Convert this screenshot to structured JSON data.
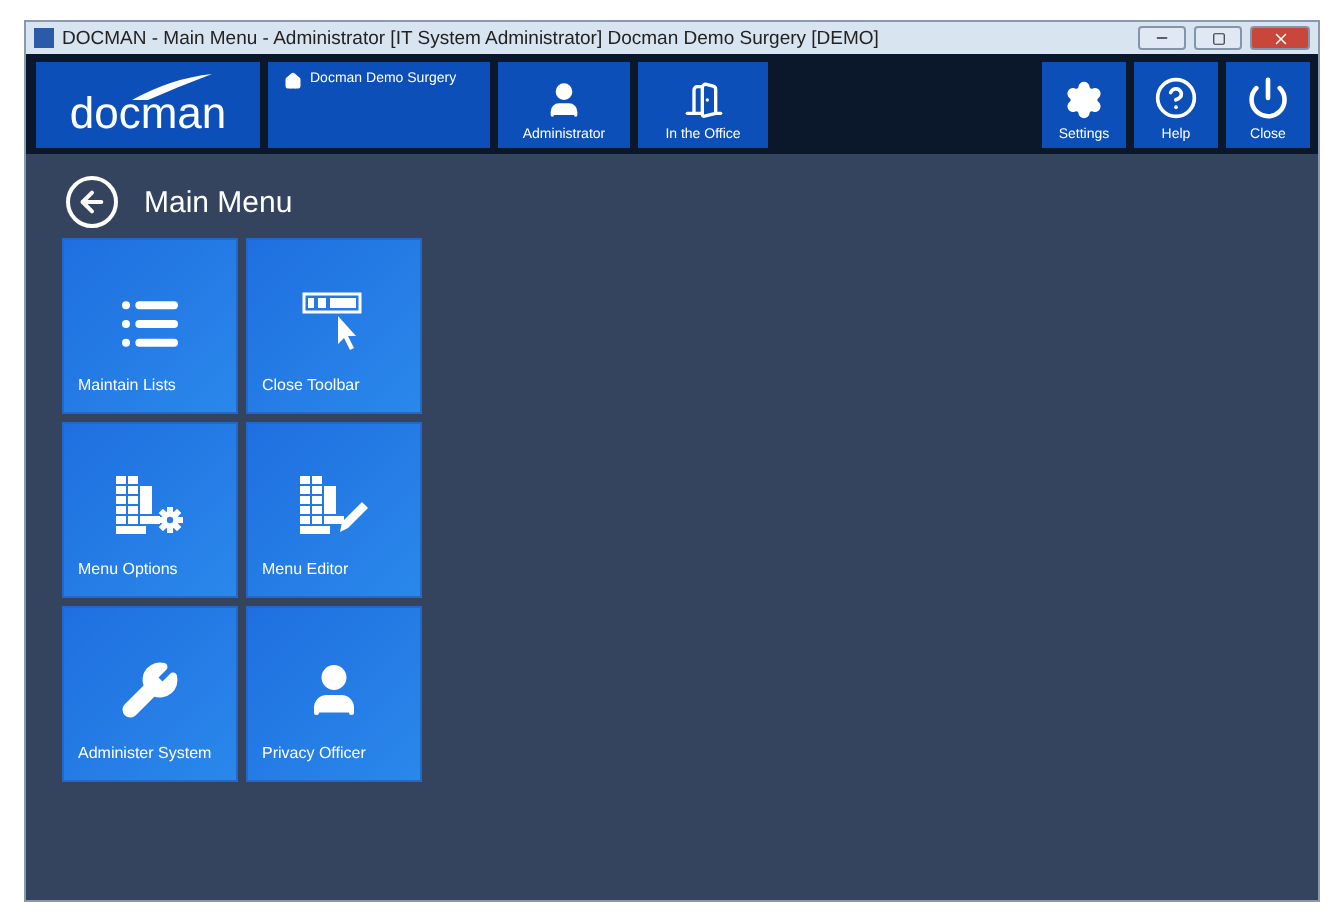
{
  "window": {
    "title": "DOCMAN - Main Menu - Administrator [IT System Administrator] Docman Demo Surgery  [DEMO]"
  },
  "header": {
    "logo": "docman",
    "site": "Docman Demo Surgery",
    "left_buttons": [
      {
        "kind": "user",
        "label": "Administrator"
      },
      {
        "kind": "door",
        "label": "In the Office"
      }
    ],
    "right_buttons": [
      {
        "kind": "settings",
        "label": "Settings"
      },
      {
        "kind": "help",
        "label": "Help"
      },
      {
        "kind": "power",
        "label": "Close"
      }
    ]
  },
  "page": {
    "title": "Main Menu"
  },
  "tiles": [
    {
      "kind": "list",
      "label": "Maintain Lists"
    },
    {
      "kind": "toolbar",
      "label": "Close Toolbar"
    },
    {
      "kind": "grid-gear",
      "label": "Menu Options"
    },
    {
      "kind": "grid-pen",
      "label": "Menu Editor"
    },
    {
      "kind": "wrench",
      "label": "Administer System"
    },
    {
      "kind": "user",
      "label": "Privacy Officer"
    }
  ]
}
